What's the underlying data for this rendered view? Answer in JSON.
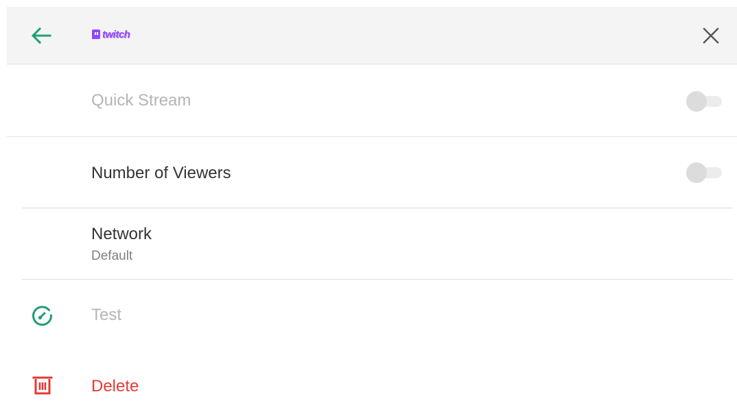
{
  "header": {
    "logo_text": "twitch",
    "back_icon": "arrow-left-icon",
    "close_icon": "close-icon",
    "accent_color": "#1e9e74",
    "brand_color": "#9146ff"
  },
  "settings": {
    "quick_stream": {
      "label": "Quick Stream",
      "enabled": false,
      "disabled": true
    },
    "number_of_viewers": {
      "label": "Number of Viewers",
      "enabled": false
    },
    "network": {
      "label": "Network",
      "value": "Default"
    }
  },
  "actions": {
    "test": {
      "label": "Test",
      "icon": "speedometer-icon",
      "disabled": true
    },
    "delete": {
      "label": "Delete",
      "icon": "trash-icon",
      "color": "#e53935"
    }
  }
}
